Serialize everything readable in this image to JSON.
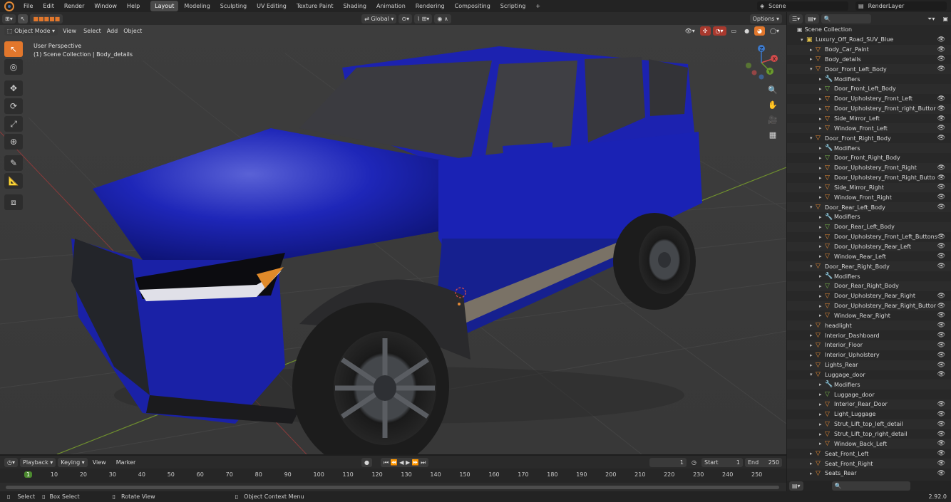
{
  "topbar": {
    "menus": [
      "File",
      "Edit",
      "Render",
      "Window",
      "Help"
    ],
    "workspaces": [
      "Layout",
      "Modeling",
      "Sculpting",
      "UV Editing",
      "Texture Paint",
      "Shading",
      "Animation",
      "Rendering",
      "Compositing",
      "Scripting"
    ],
    "active_workspace": "Layout",
    "add_tab": "+",
    "scene": "Scene",
    "render_layer": "RenderLayer"
  },
  "viewport_header": {
    "transform": "Global",
    "options": "Options"
  },
  "viewport_header2": {
    "mode": "Object Mode",
    "menus": [
      "View",
      "Select",
      "Add",
      "Object"
    ]
  },
  "viewport": {
    "perspective": "User Perspective",
    "context": "(1) Scene Collection | Body_details"
  },
  "gizmo": {
    "x": "X",
    "y": "Y",
    "z": "Z"
  },
  "timeline": {
    "menus": [
      "Playback",
      "Keying",
      "View",
      "Marker"
    ],
    "current_frame": "1",
    "start_label": "Start",
    "start": "1",
    "end_label": "End",
    "end": "250",
    "ticks": [
      "1",
      "10",
      "20",
      "30",
      "40",
      "50",
      "60",
      "70",
      "80",
      "90",
      "100",
      "110",
      "120",
      "130",
      "140",
      "150",
      "160",
      "170",
      "180",
      "190",
      "200",
      "210",
      "220",
      "230",
      "240",
      "250"
    ]
  },
  "statusbar": {
    "select": "Select",
    "box_select": "Box Select",
    "rotate": "Rotate View",
    "context_menu": "Object Context Menu",
    "version": "2.92.0"
  },
  "outliner": {
    "root": "Scene Collection",
    "rows": [
      {
        "name": "Luxury_Off_Road_SUV_Blue",
        "indent": 1,
        "open": true,
        "icon": "collection"
      },
      {
        "name": "Body_Car_Paint",
        "indent": 2,
        "open": false,
        "icon": "mesh"
      },
      {
        "name": "Body_details",
        "indent": 2,
        "open": false,
        "icon": "mesh"
      },
      {
        "name": "Door_Front_Left_Body",
        "indent": 2,
        "open": true,
        "icon": "mesh"
      },
      {
        "name": "Modifiers",
        "indent": 3,
        "open": false,
        "icon": "modifier"
      },
      {
        "name": "Door_Front_Left_Body",
        "indent": 3,
        "open": false,
        "icon": "meshdata"
      },
      {
        "name": "Door_Upholstery_Front_Left",
        "indent": 3,
        "open": false,
        "icon": "mesh"
      },
      {
        "name": "Door_Upholstery_Front_right_Buttor",
        "indent": 3,
        "open": false,
        "icon": "mesh"
      },
      {
        "name": "Side_Mirror_Left",
        "indent": 3,
        "open": false,
        "icon": "mesh"
      },
      {
        "name": "Window_Front_Left",
        "indent": 3,
        "open": false,
        "icon": "mesh"
      },
      {
        "name": "Door_Front_Right_Body",
        "indent": 2,
        "open": true,
        "icon": "mesh"
      },
      {
        "name": "Modifiers",
        "indent": 3,
        "open": false,
        "icon": "modifier"
      },
      {
        "name": "Door_Front_Right_Body",
        "indent": 3,
        "open": false,
        "icon": "meshdata"
      },
      {
        "name": "Door_Upholstery_Front_Right",
        "indent": 3,
        "open": false,
        "icon": "mesh"
      },
      {
        "name": "Door_Upholstery_Front_Right_Butto",
        "indent": 3,
        "open": false,
        "icon": "mesh"
      },
      {
        "name": "Side_Mirror_Right",
        "indent": 3,
        "open": false,
        "icon": "mesh"
      },
      {
        "name": "Window_Front_Right",
        "indent": 3,
        "open": false,
        "icon": "mesh"
      },
      {
        "name": "Door_Rear_Left_Body",
        "indent": 2,
        "open": true,
        "icon": "mesh"
      },
      {
        "name": "Modifiers",
        "indent": 3,
        "open": false,
        "icon": "modifier"
      },
      {
        "name": "Door_Rear_Left_Body",
        "indent": 3,
        "open": false,
        "icon": "meshdata"
      },
      {
        "name": "Door_Upholstery_Front_Left_Buttons",
        "indent": 3,
        "open": false,
        "icon": "mesh"
      },
      {
        "name": "Door_Upholstery_Rear_Left",
        "indent": 3,
        "open": false,
        "icon": "mesh"
      },
      {
        "name": "Window_Rear_Left",
        "indent": 3,
        "open": false,
        "icon": "mesh"
      },
      {
        "name": "Door_Rear_Right_Body",
        "indent": 2,
        "open": true,
        "icon": "mesh"
      },
      {
        "name": "Modifiers",
        "indent": 3,
        "open": false,
        "icon": "modifier"
      },
      {
        "name": "Door_Rear_Right_Body",
        "indent": 3,
        "open": false,
        "icon": "meshdata"
      },
      {
        "name": "Door_Upholstery_Rear_Right",
        "indent": 3,
        "open": false,
        "icon": "mesh"
      },
      {
        "name": "Door_Upholstery_Rear_Right_Buttor",
        "indent": 3,
        "open": false,
        "icon": "mesh"
      },
      {
        "name": "Window_Rear_Right",
        "indent": 3,
        "open": false,
        "icon": "mesh"
      },
      {
        "name": "headlight",
        "indent": 2,
        "open": false,
        "icon": "mesh"
      },
      {
        "name": "Interior_Dashboard",
        "indent": 2,
        "open": false,
        "icon": "mesh"
      },
      {
        "name": "Interior_Floor",
        "indent": 2,
        "open": false,
        "icon": "mesh"
      },
      {
        "name": "Interior_Upholstery",
        "indent": 2,
        "open": false,
        "icon": "mesh"
      },
      {
        "name": "Lights_Rear",
        "indent": 2,
        "open": false,
        "icon": "mesh"
      },
      {
        "name": "Luggage_door",
        "indent": 2,
        "open": true,
        "icon": "mesh"
      },
      {
        "name": "Modifiers",
        "indent": 3,
        "open": false,
        "icon": "modifier"
      },
      {
        "name": "Luggage_door",
        "indent": 3,
        "open": false,
        "icon": "meshdata"
      },
      {
        "name": "Interior_Rear_Door",
        "indent": 3,
        "open": false,
        "icon": "mesh"
      },
      {
        "name": "Light_Luggage",
        "indent": 3,
        "open": false,
        "icon": "mesh"
      },
      {
        "name": "Strut_Lift_top_left_detail",
        "indent": 3,
        "open": false,
        "icon": "mesh"
      },
      {
        "name": "Strut_Lift_top_right_detail",
        "indent": 3,
        "open": false,
        "icon": "mesh"
      },
      {
        "name": "Window_Back_Left",
        "indent": 3,
        "open": false,
        "icon": "mesh"
      },
      {
        "name": "Seat_Front_Left",
        "indent": 2,
        "open": false,
        "icon": "mesh"
      },
      {
        "name": "Seat_Front_Right",
        "indent": 2,
        "open": false,
        "icon": "mesh"
      },
      {
        "name": "Seats_Rear",
        "indent": 2,
        "open": false,
        "icon": "mesh"
      }
    ]
  }
}
